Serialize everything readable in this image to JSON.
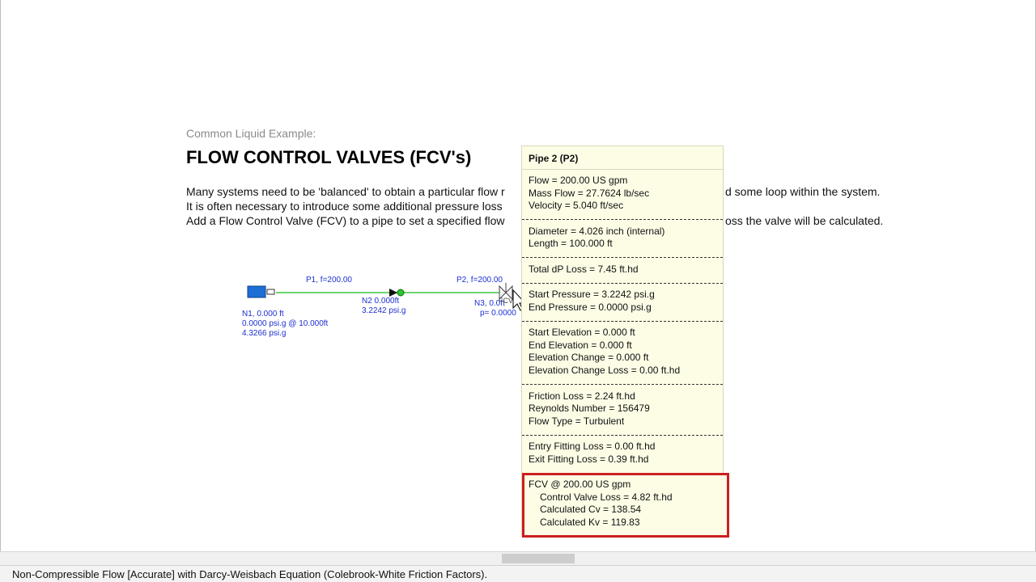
{
  "document": {
    "subtitle": "Common Liquid Example:",
    "title": "FLOW CONTROL VALVES (FCV's)",
    "paragraph": [
      "Many systems need to be 'balanced' to obtain a particular flow r",
      "d some loop within the system.",
      "It is often necessary to introduce some additional pressure loss",
      "Add a Flow Control Valve (FCV) to a pipe to set a specified flow",
      "oss the valve will be calculated."
    ]
  },
  "network": {
    "pipe1_label": "P1, f=200.00",
    "pipe2_label": "P2, f=200.00",
    "node1": [
      "N1, 0.000 ft",
      "0.0000 psi.g @ 10.000ft",
      "4.3266 psi.g"
    ],
    "node2": [
      "N2 0.000ft",
      "3.2242 psi.g"
    ],
    "node3": [
      "N3, 0.0ft",
      "p= 0.0000"
    ],
    "valve_tag": "FCV",
    "pipe_color": "#6fd36f",
    "label_color": "#1c2fd0",
    "tank_color": "#1d6fd6"
  },
  "tooltip": {
    "title": "Pipe 2 (P2)",
    "groups": [
      [
        "Flow = 200.00 US gpm",
        "Mass Flow = 27.7624 lb/sec",
        "Velocity = 5.040 ft/sec"
      ],
      [
        "Diameter = 4.026 inch (internal)",
        "Length = 100.000 ft"
      ],
      [
        "Total dP Loss = 7.45 ft.hd"
      ],
      [
        "Start Pressure = 3.2242 psi.g",
        "End Pressure = 0.0000 psi.g"
      ],
      [
        "Start Elevation = 0.000 ft",
        "End Elevation = 0.000 ft",
        "Elevation Change = 0.000 ft",
        "Elevation Change Loss = 0.00 ft.hd"
      ],
      [
        "Friction Loss = 2.24 ft.hd",
        "Reynolds Number = 156479",
        "Flow Type = Turbulent"
      ],
      [
        "Entry Fitting Loss = 0.00 ft.hd",
        "Exit Fitting Loss = 0.39 ft.hd"
      ]
    ],
    "fcv": {
      "header": "FCV @ 200.00 US gpm",
      "lines": [
        "Control Valve Loss = 4.82 ft.hd",
        "Calculated Cv = 138.54",
        "Calculated Kv = 119.83"
      ],
      "highlight_color": "#cc1f1f"
    }
  },
  "statusbar": {
    "text": "Non-Compressible Flow [Accurate] with Darcy-Weisbach Equation (Colebrook-White Friction Factors)."
  }
}
